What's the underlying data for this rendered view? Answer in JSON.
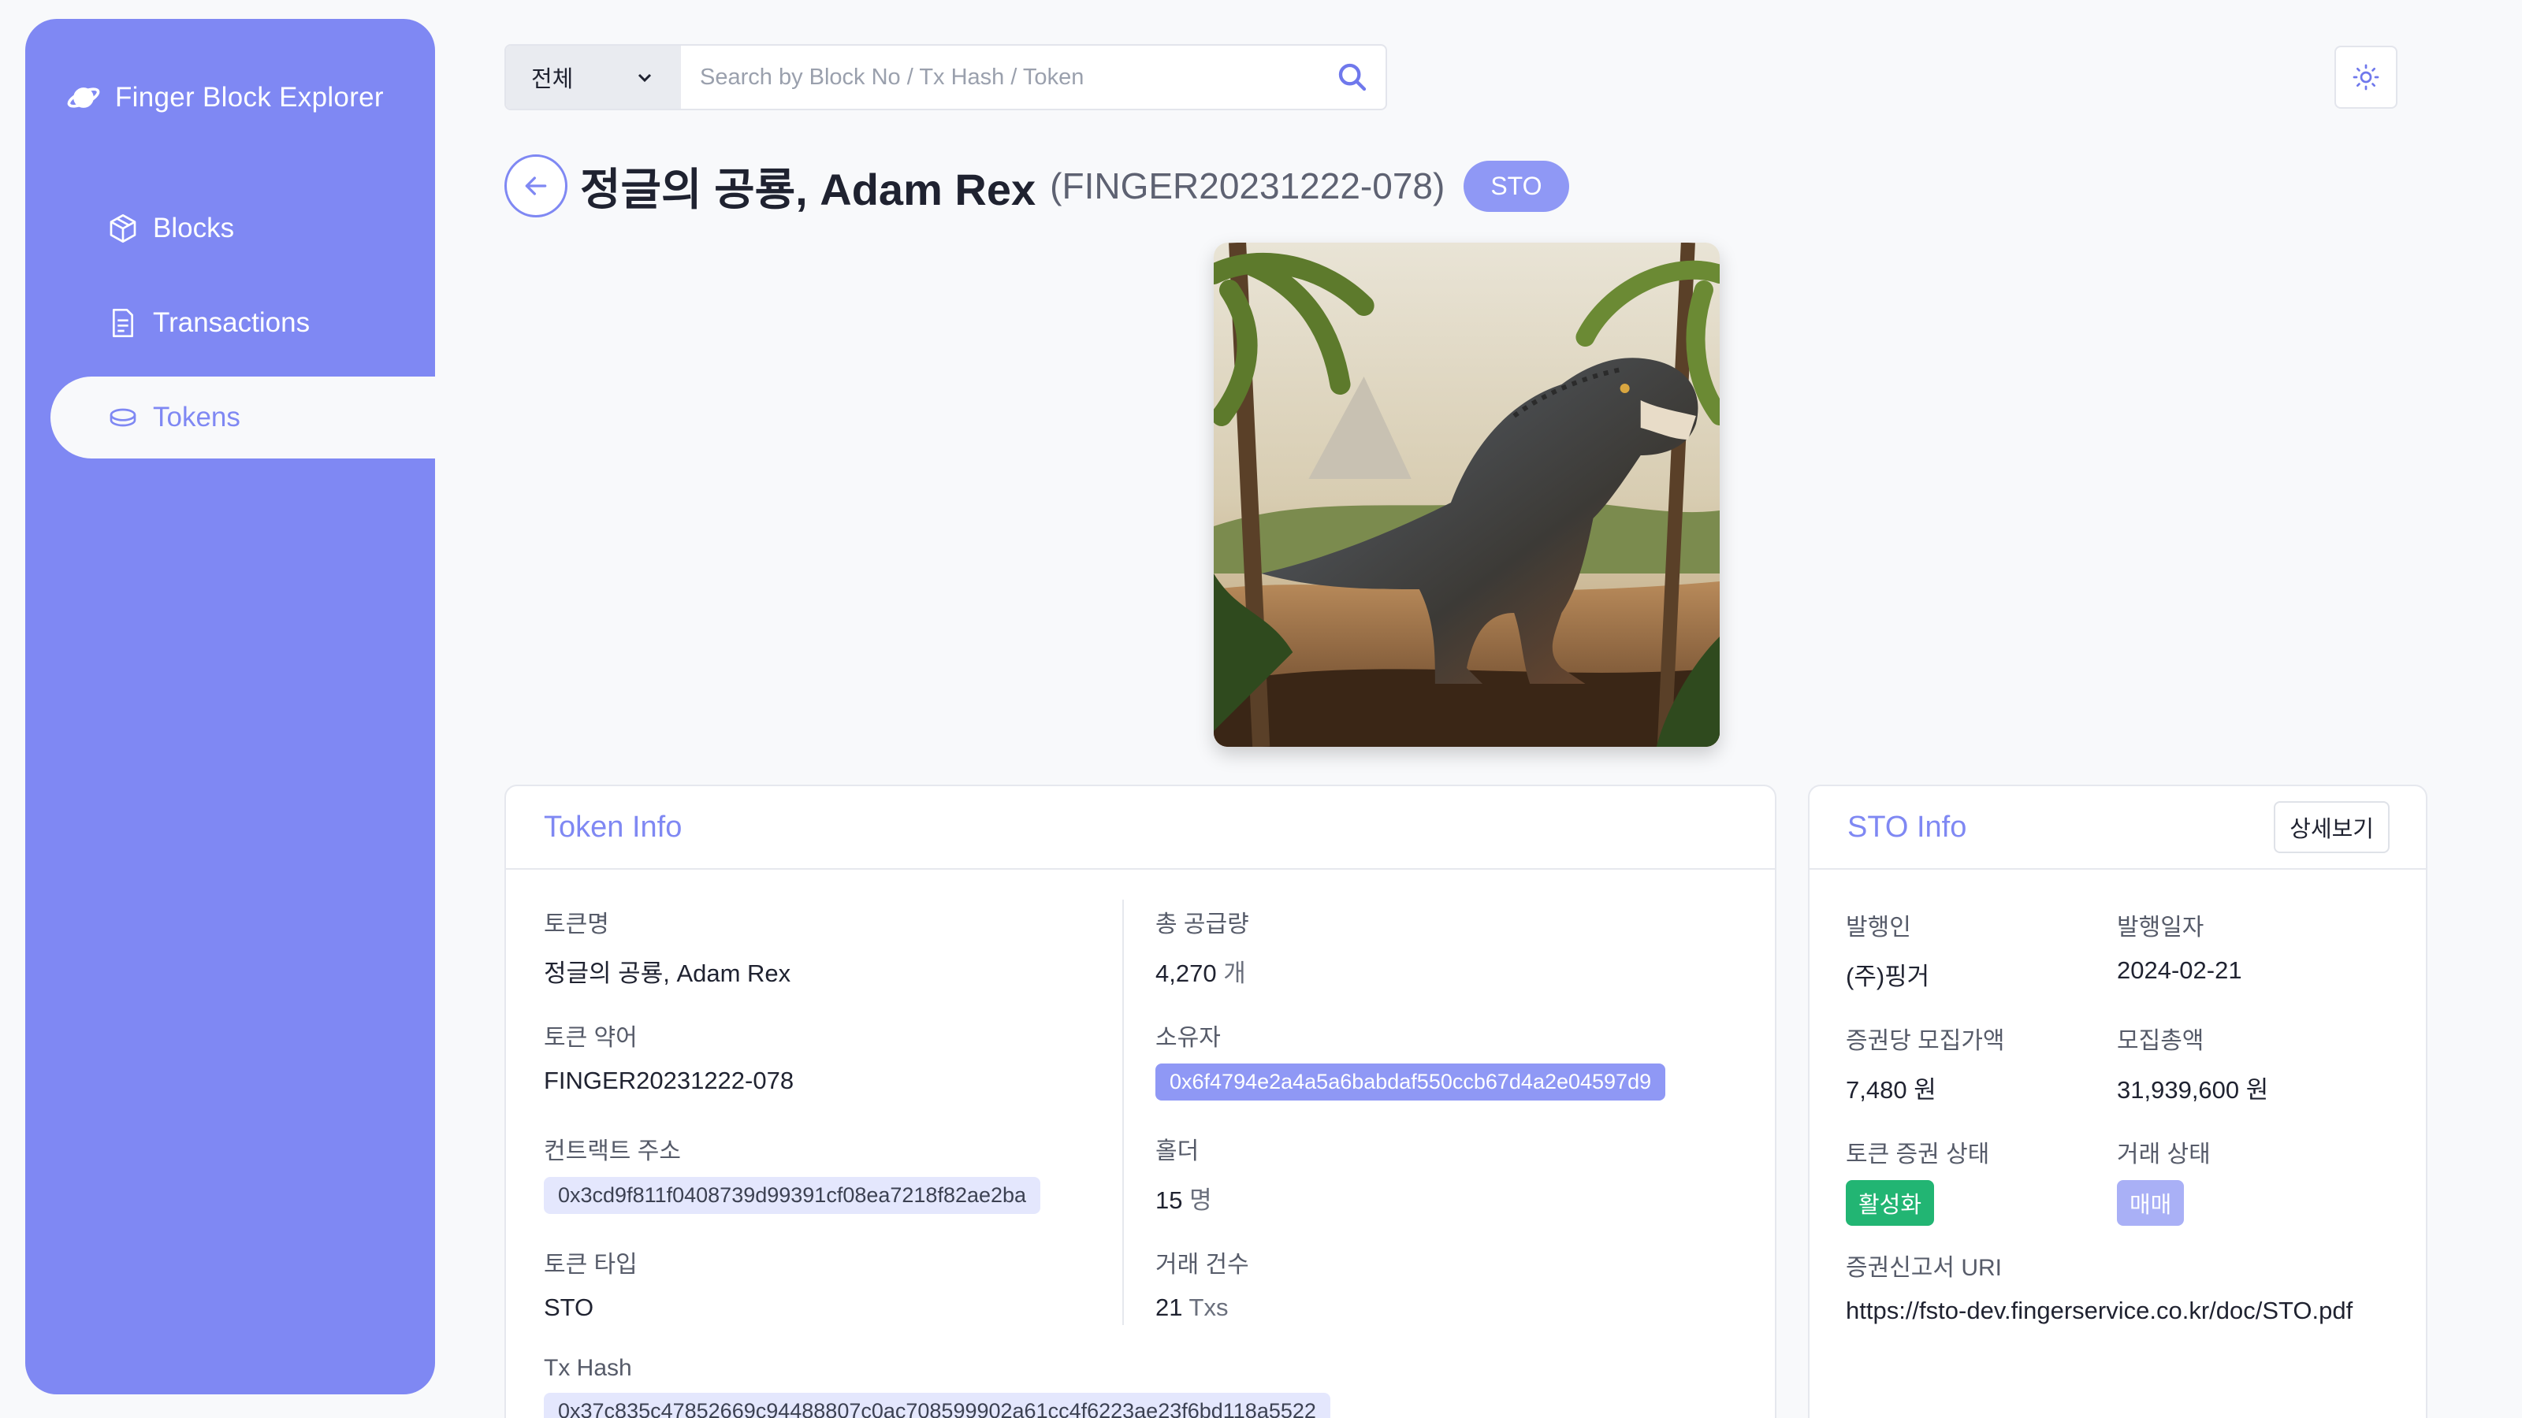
{
  "sidebar": {
    "brand": "Finger Block Explorer",
    "items": [
      {
        "label": "Blocks",
        "icon": "cube-icon"
      },
      {
        "label": "Transactions",
        "icon": "document-icon"
      },
      {
        "label": "Tokens",
        "icon": "coin-icon",
        "active": true
      }
    ]
  },
  "search": {
    "filter_value": "전체",
    "placeholder": "Search by Block No / Tx Hash / Token"
  },
  "header": {
    "name": "정글의 공룡, Adam Rex",
    "symbol": "(FINGER20231222-078)",
    "type_badge": "STO"
  },
  "token_info": {
    "title": "Token Info",
    "name_label": "토큰명",
    "name_value": "정글의 공룡, Adam Rex",
    "symbol_label": "토큰 약어",
    "symbol_value": "FINGER20231222-078",
    "contract_label": "컨트랙트 주소",
    "contract_value": "0x3cd9f811f0408739d99391cf08ea7218f82ae2ba",
    "type_label": "토큰 타입",
    "type_value": "STO",
    "txhash_label": "Tx Hash",
    "txhash_value": "0x37c835c47852669c94488807c0ac708599902a61cc4f6223ae23f6bd118a5522",
    "supply_label": "총 공급량",
    "supply_value": "4,270",
    "supply_unit": "개",
    "owner_label": "소유자",
    "owner_value": "0x6f4794e2a4a5a6babdaf550ccb67d4a2e04597d9",
    "holders_label": "홀더",
    "holders_value": "15",
    "holders_unit": "명",
    "tx_count_label": "거래 건수",
    "tx_count_value": "21",
    "tx_count_unit": "Txs"
  },
  "sto_info": {
    "title": "STO Info",
    "detail_button": "상세보기",
    "issuer_label": "발행인",
    "issuer_value": "(주)핑거",
    "issue_date_label": "발행일자",
    "issue_date_value": "2024-02-21",
    "price_label": "증권당 모집가액",
    "price_value": "7,480 원",
    "total_label": "모집총액",
    "total_value": "31,939,600 원",
    "token_status_label": "토큰 증권 상태",
    "token_status_value": "활성화",
    "trade_status_label": "거래 상태",
    "trade_status_value": "매매",
    "uri_label": "증권신고서 URI",
    "uri_value": "https://fsto-dev.fingerservice.co.kr/doc/STO.pdf"
  },
  "colors": {
    "accent": "#7f88f3",
    "active_status": "#22b573"
  }
}
